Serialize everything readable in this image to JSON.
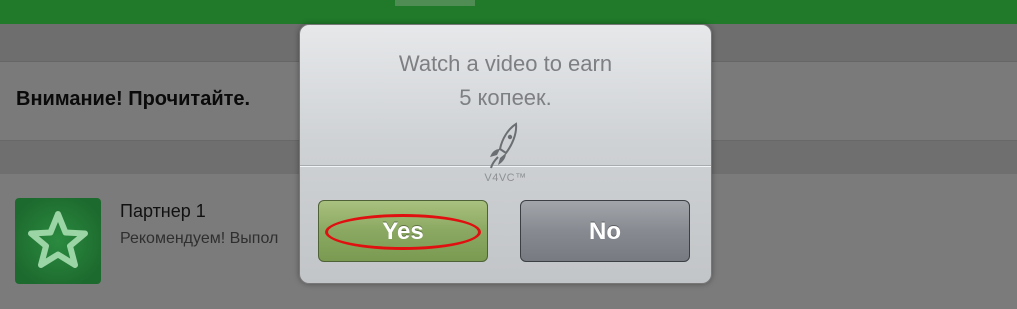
{
  "background": {
    "notice": "Внимание!  Прочитайте.",
    "partner": {
      "title": "Партнер 1",
      "subtitle": "Рекомендуем! Выпол"
    }
  },
  "dialog": {
    "message_line1": "Watch a video to earn",
    "message_line2": "5 копеек.",
    "logo_text": "V4VC™",
    "yes_label": "Yes",
    "no_label": "No"
  },
  "colors": {
    "topbar": "#207a2a",
    "yes_button": "#8aa861",
    "no_button": "#878b91",
    "highlight": "#e01010"
  },
  "icons": {
    "partner_icon": "star-icon",
    "logo": "rocket-icon"
  }
}
